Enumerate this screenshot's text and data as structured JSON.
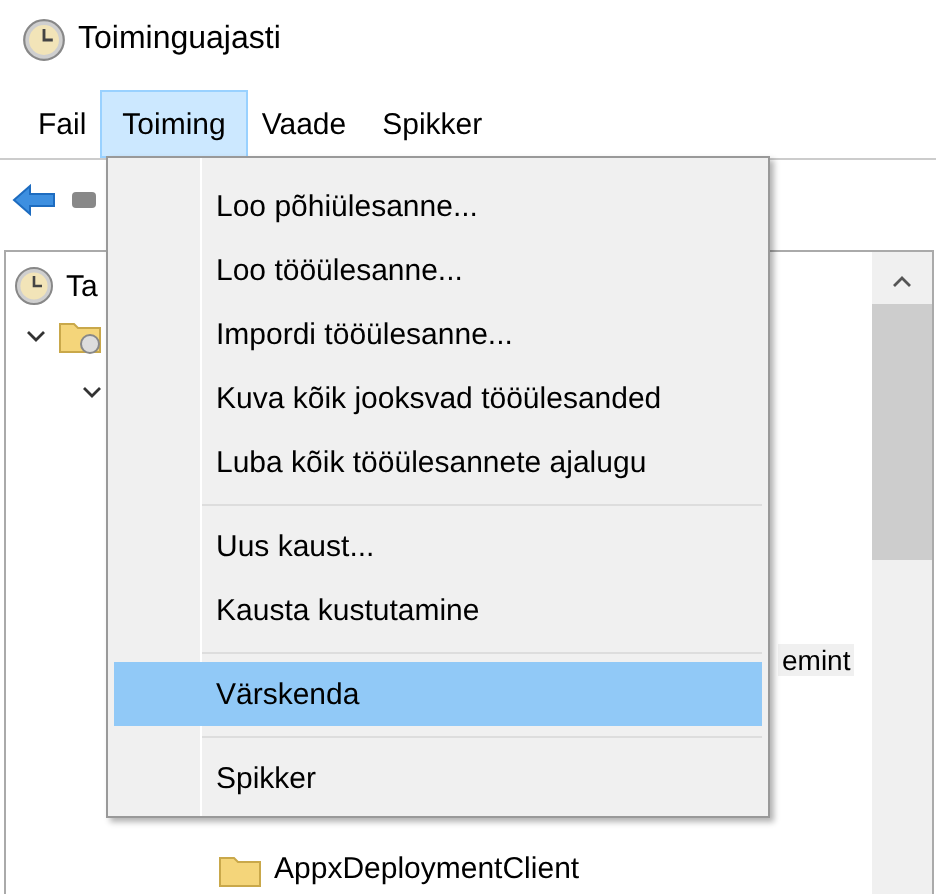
{
  "window": {
    "title": "Toiminguajasti"
  },
  "menu_bar": [
    {
      "label": "Fail",
      "selected": false
    },
    {
      "label": "Toiming",
      "selected": true
    },
    {
      "label": "Vaade",
      "selected": false
    },
    {
      "label": "Spikker",
      "selected": false
    }
  ],
  "tree": [
    {
      "label": "Ta",
      "kind": "clock",
      "selected": false,
      "children": [
        {
          "kind": "folder",
          "expanded": true,
          "children": [
            {
              "expanded": true,
              "children": [
                {
                  "kind": "cut",
                  "label": "emint",
                  "selected": true
                },
                {
                  "kind": "folder",
                  "label": "AppxDeploymentClient",
                  "selected": false
                }
              ]
            }
          ]
        }
      ]
    }
  ],
  "dropdown": [
    {
      "label": "Loo põhiülesanne...",
      "selected": false
    },
    {
      "label": "Loo tööülesanne...",
      "selected": false
    },
    {
      "label": "Impordi tööülesanne...",
      "selected": false
    },
    {
      "label": "Kuva kõik jooksvad tööülesanded",
      "selected": false
    },
    {
      "label": "Luba kõik tööülesannete ajalugu",
      "selected": false
    },
    {
      "kind": "separator"
    },
    {
      "label": "Uus kaust...",
      "selected": false
    },
    {
      "label": "Kausta kustutamine",
      "selected": false
    },
    {
      "kind": "separator"
    },
    {
      "label": "Värskenda",
      "selected": true
    },
    {
      "kind": "separator"
    },
    {
      "label": "Spikker",
      "selected": false
    }
  ]
}
